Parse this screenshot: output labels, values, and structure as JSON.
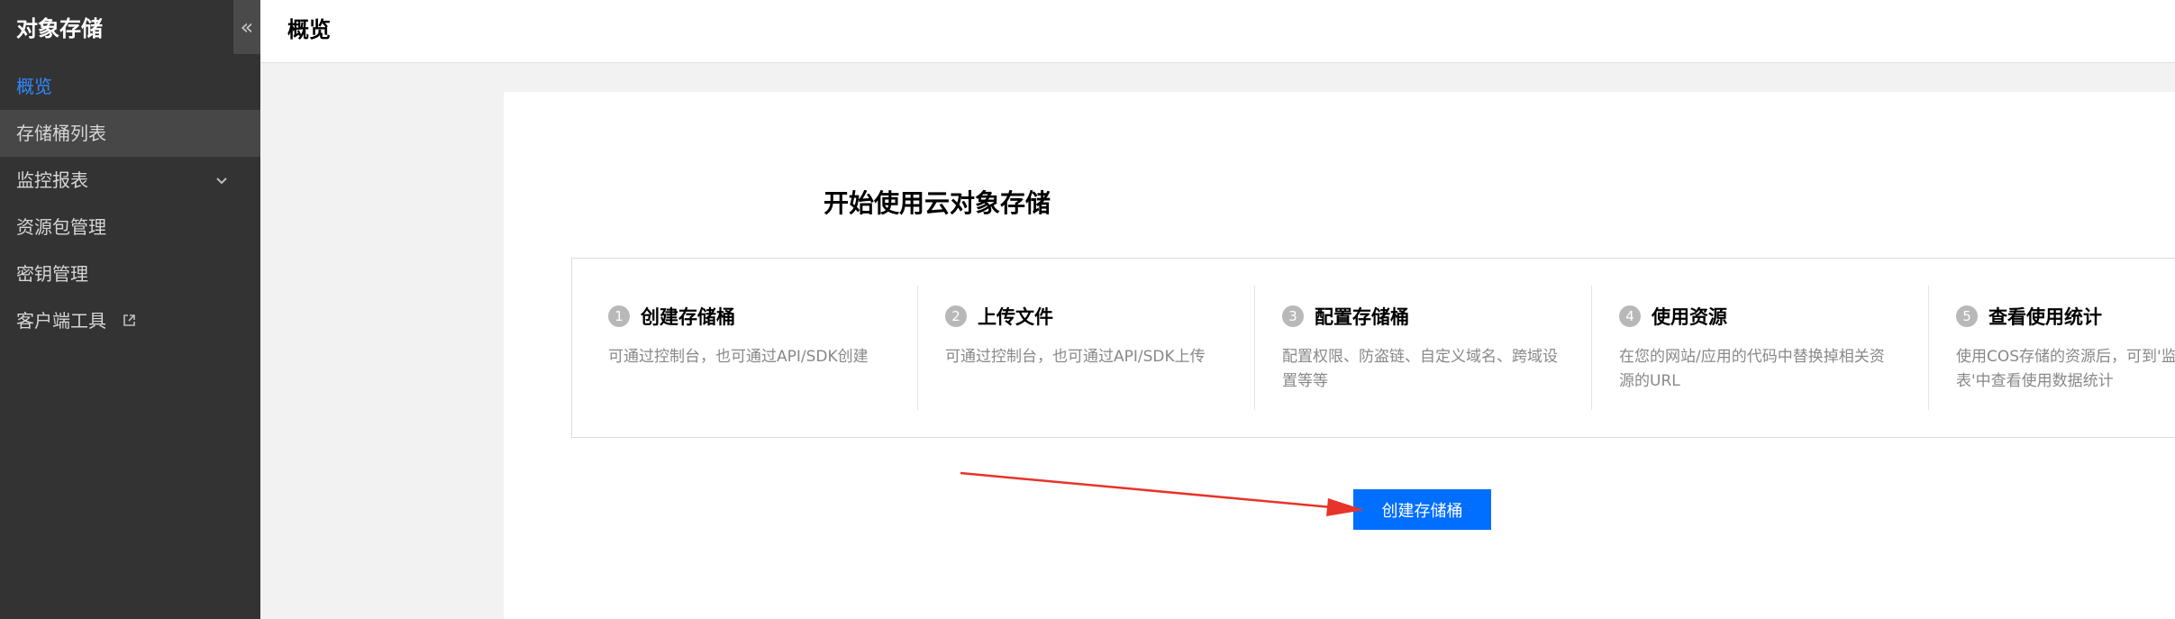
{
  "sidebar": {
    "title": "对象存储",
    "collapse_icon": "«",
    "items": [
      {
        "label": "概览",
        "state": "active"
      },
      {
        "label": "存储桶列表",
        "state": "hover"
      },
      {
        "label": "监控报表",
        "icon": "chevron-down-icon"
      },
      {
        "label": "资源包管理"
      },
      {
        "label": "密钥管理"
      },
      {
        "label": "客户端工具",
        "icon": "external-link-icon"
      }
    ]
  },
  "header": {
    "title": "概览"
  },
  "main": {
    "title": "开始使用云对象存储",
    "steps": [
      {
        "num": "1",
        "title": "创建存储桶",
        "desc": "可通过控制台，也可通过API/SDK创建"
      },
      {
        "num": "2",
        "title": "上传文件",
        "desc": "可通过控制台，也可通过API/SDK上传"
      },
      {
        "num": "3",
        "title": "配置存储桶",
        "desc": "配置权限、防盗链、自定义域名、跨域设置等等"
      },
      {
        "num": "4",
        "title": "使用资源",
        "desc": "在您的网站/应用的代码中替换掉相关资源的URL"
      },
      {
        "num": "5",
        "title": "查看使用统计",
        "desc": "使用COS存储的资源后，可到'监控报表'中查看使用数据统计"
      }
    ],
    "create_button": "创建存储桶"
  },
  "colors": {
    "sidebar_bg": "#333333",
    "accent": "#006eff",
    "active_nav": "#2f8bff",
    "annotation_arrow": "#e8332a"
  }
}
